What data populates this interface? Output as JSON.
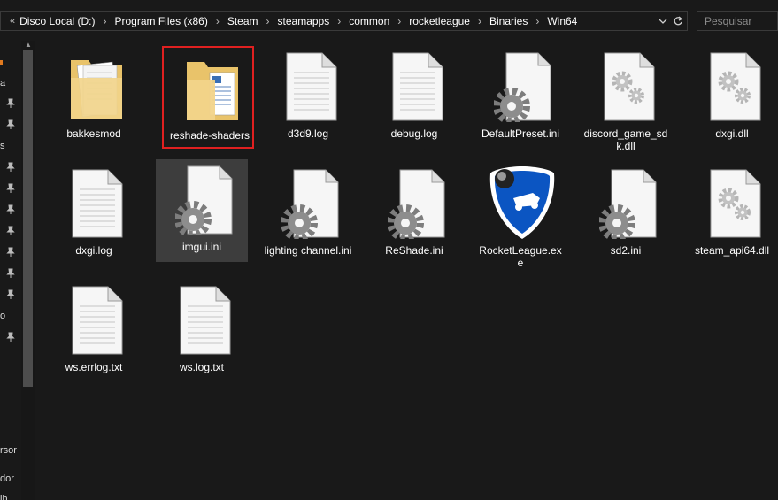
{
  "address": {
    "lead": "«",
    "crumbs": [
      "Disco Local (D:)",
      "Program Files (x86)",
      "Steam",
      "steamapps",
      "common",
      "rocketleague",
      "Binaries",
      "Win64"
    ],
    "separator": "›"
  },
  "search": {
    "placeholder": "Pesquisar"
  },
  "sidebar": {
    "fragments": [
      "a",
      "s",
      "o",
      "rsor",
      "dor",
      "lh"
    ]
  },
  "items": [
    {
      "name": "bakkesmod",
      "type": "folder"
    },
    {
      "name": "reshade-shaders",
      "type": "folder-docs"
    },
    {
      "name": "d3d9.log",
      "type": "text"
    },
    {
      "name": "debug.log",
      "type": "text"
    },
    {
      "name": "DefaultPreset.ini",
      "type": "ini"
    },
    {
      "name": "discord_game_sdk.dll",
      "type": "dll"
    },
    {
      "name": "dxgi.dll",
      "type": "dll"
    },
    {
      "name": "dxgi.log",
      "type": "text"
    },
    {
      "name": "imgui.ini",
      "type": "ini"
    },
    {
      "name": "lighting channel.ini",
      "type": "ini"
    },
    {
      "name": "ReShade.ini",
      "type": "ini"
    },
    {
      "name": "RocketLeague.exe",
      "type": "exe"
    },
    {
      "name": "sd2.ini",
      "type": "ini"
    },
    {
      "name": "steam_api64.dll",
      "type": "dll"
    },
    {
      "name": "ws.errlog.txt",
      "type": "text"
    },
    {
      "name": "ws.log.txt",
      "type": "text"
    }
  ],
  "colors": {
    "background": "#191919",
    "selection": "#3d3d3d",
    "highlight_border": "#e02020"
  }
}
